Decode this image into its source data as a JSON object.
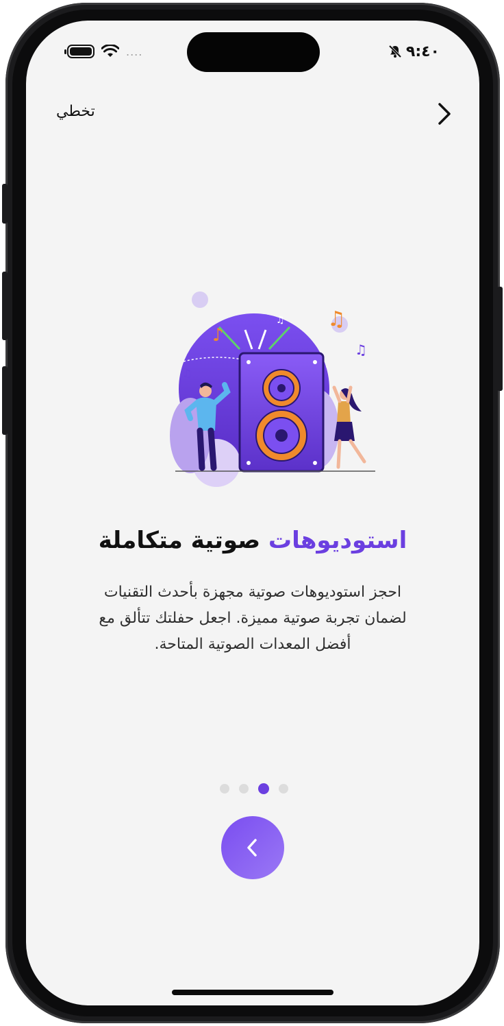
{
  "status_bar": {
    "time": "٩:٤٠",
    "signal_dots": "....",
    "icons": [
      "battery-icon",
      "wifi-icon",
      "bell-slash-icon"
    ]
  },
  "header": {
    "skip_label": "تخطي",
    "back_icon": "chevron-right-icon"
  },
  "onboarding": {
    "title_highlight": "استوديوهات",
    "title_rest": " صوتية متكاملة",
    "description": "احجز استوديوهات صوتية مجهزة بأحدث التقنيات لضمان تجربة صوتية مميزة. اجعل حفلتك تتألق مع أفضل المعدات الصوتية المتاحة.",
    "illustration": "speaker-party-illustration",
    "page_count": 4,
    "active_page_index": 2,
    "next_icon": "chevron-left-icon"
  },
  "colors": {
    "accent": "#6b3fe0",
    "background": "#f4f4f4",
    "dot_inactive": "#dcdcdc"
  }
}
